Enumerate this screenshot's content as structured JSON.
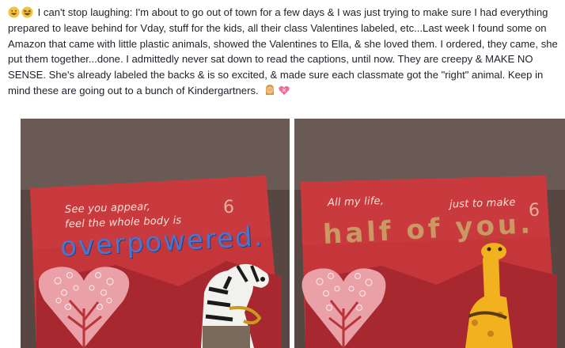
{
  "post": {
    "emoji_lead": [
      "grinning-face",
      "grinning-squinting-face"
    ],
    "text": "I can't stop laughing: I'm about to go out of town for a few days & I was just trying to make sure I had everything prepared to leave behind for Vday, stuff for the kids, all their class Valentines labeled, etc...Last week I found some on Amazon that came with little plastic animals, showed the Valentines to Ella, & she loved them. I ordered, they came, she put them together...done. I admittedly never sat down to read the captions, until now. They are creepy & MAKE NO SENSE. She's already labeled the backs & is so excited, & made sure each classmate got the \"right\" animal. Keep in mind these are going out to a bunch of Kindergartners.",
    "emoji_trail": [
      "woman-facepalming",
      "heart-with-ribbon"
    ]
  },
  "photos": [
    {
      "caption_line1": "See you appear,",
      "caption_line2": "feel the whole body is",
      "big_word": "overpowered.",
      "number": "6",
      "animal": "zebra-toy"
    },
    {
      "caption_part1": "All my life,",
      "caption_part2": "just to make",
      "big_word": "half of you.",
      "number": "6",
      "animal": "giraffe-toy"
    }
  ],
  "colors": {
    "text": "#1d2129",
    "card_red": "#c4363a",
    "card_dark": "#a82830",
    "heart_pink": "#e9a0a6",
    "blue_word": "#4f74c9",
    "tan_word": "#c9a96a"
  }
}
